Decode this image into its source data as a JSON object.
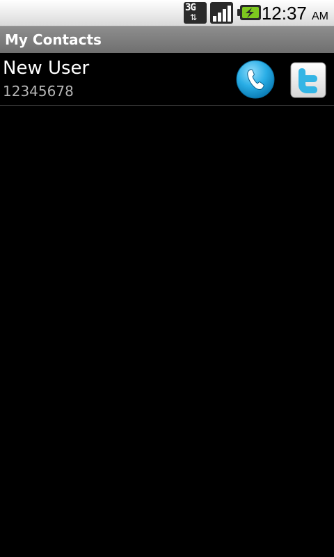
{
  "status_bar": {
    "network_label": "3G",
    "time": "12:37",
    "ampm": "AM",
    "icons": [
      "3g-data-icon",
      "signal-strength-icon",
      "battery-charging-icon"
    ]
  },
  "title_bar": {
    "title": "My Contacts"
  },
  "contacts": [
    {
      "name": "New User",
      "number": "12345678",
      "actions": [
        "phone-icon",
        "twitter-icon"
      ]
    }
  ],
  "colors": {
    "background": "#000000",
    "title_bar": "#7d7d7d",
    "call_button": "#29aee6",
    "twitter_blue": "#33b5e5",
    "secondary_text": "#b5b5b5"
  }
}
